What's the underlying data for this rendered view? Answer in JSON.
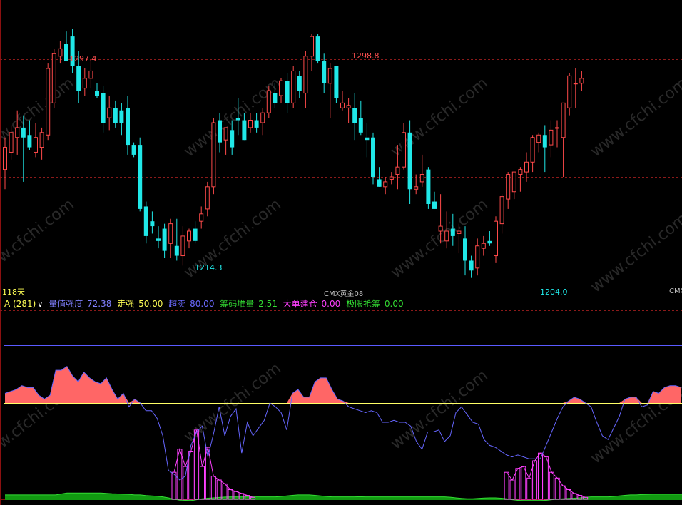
{
  "colors": {
    "up": "#ff4a4a",
    "down": "#20e8e8",
    "frame": "#8b1010",
    "grid": "#8b1a1a",
    "strength_line": "#6666ff",
    "strength_fill": "#ff6666",
    "level_high": "#5a5aff",
    "level_low": "#ffff66",
    "chip_pink": "#ff40ff",
    "chip_green": "#33dd33",
    "watermark": "#4a4a4a"
  },
  "top_labels": {
    "period": "118天",
    "symbol_mid": "CMX黄金08",
    "symbol_right": "CMX"
  },
  "price_labels": {
    "high1": "1297.4",
    "high2": "1298.8",
    "low1": "1214.3",
    "low2": "1204.0"
  },
  "legend": {
    "indicator": "A (281)",
    "dropdown_icon": "chevron-down-icon",
    "items": [
      {
        "name": "量值强度",
        "value": "72.38",
        "color": "#8080ff"
      },
      {
        "name": "走强",
        "value": "50.00",
        "color": "#ffff55"
      },
      {
        "name": "超卖",
        "value": "80.00",
        "color": "#6a6aff"
      },
      {
        "name": "筹码堆量",
        "value": "2.51",
        "color": "#33dd33"
      },
      {
        "name": "大单建仓",
        "value": "0.00",
        "color": "#ff40ff"
      },
      {
        "name": "极限抢筹",
        "value": "0.00",
        "color": "#33dd33"
      }
    ]
  },
  "watermark": "www.cfchi.com",
  "chart_data": [
    {
      "type": "candlestick",
      "title": "CMX黄金08",
      "ylim": [
        1196,
        1306
      ],
      "ohlc": [
        [
          1243,
          1256,
          1235,
          1252
        ],
        [
          1250,
          1261,
          1247,
          1258
        ],
        [
          1256,
          1267,
          1249,
          1260
        ],
        [
          1260,
          1265,
          1238,
          1256
        ],
        [
          1257,
          1263,
          1251,
          1252
        ],
        [
          1250,
          1262,
          1248,
          1256
        ],
        [
          1252,
          1260,
          1247,
          1258
        ],
        [
          1257,
          1286,
          1255,
          1284
        ],
        [
          1270,
          1292,
          1268,
          1290
        ],
        [
          1289,
          1295,
          1286,
          1292
        ],
        [
          1294,
          1299,
          1289,
          1287
        ],
        [
          1297,
          1300,
          1282,
          1285
        ],
        [
          1285,
          1291,
          1270,
          1275
        ],
        [
          1276,
          1284,
          1273,
          1280
        ],
        [
          1280,
          1287,
          1276,
          1283
        ],
        [
          1275,
          1278,
          1272,
          1273
        ],
        [
          1274,
          1277,
          1258,
          1262
        ],
        [
          1264,
          1273,
          1259,
          1268
        ],
        [
          1268,
          1271,
          1260,
          1262
        ],
        [
          1267,
          1270,
          1257,
          1262
        ],
        [
          1268,
          1273,
          1249,
          1253
        ],
        [
          1253,
          1254,
          1248,
          1249
        ],
        [
          1253,
          1256,
          1226,
          1227
        ],
        [
          1228,
          1230,
          1213,
          1216
        ],
        [
          1222,
          1226,
          1217,
          1220
        ],
        [
          1215,
          1220,
          1211,
          1214
        ],
        [
          1219,
          1221,
          1207,
          1210
        ],
        [
          1213,
          1223,
          1207,
          1221
        ],
        [
          1212,
          1223,
          1206,
          1208
        ],
        [
          1208,
          1220,
          1204,
          1216
        ],
        [
          1214,
          1219,
          1211,
          1218
        ],
        [
          1219,
          1222,
          1213,
          1214
        ],
        [
          1222,
          1228,
          1219,
          1225
        ],
        [
          1227,
          1238,
          1224,
          1236
        ],
        [
          1236,
          1264,
          1233,
          1262
        ],
        [
          1263,
          1266,
          1250,
          1254
        ],
        [
          1255,
          1260,
          1249,
          1260
        ],
        [
          1259,
          1263,
          1249,
          1252
        ],
        [
          1264,
          1272,
          1257,
          1263
        ],
        [
          1263,
          1266,
          1255,
          1255
        ],
        [
          1260,
          1266,
          1258,
          1263
        ],
        [
          1263,
          1266,
          1258,
          1260
        ],
        [
          1262,
          1268,
          1257,
          1266
        ],
        [
          1266,
          1277,
          1264,
          1275
        ],
        [
          1274,
          1278,
          1268,
          1270
        ],
        [
          1273,
          1280,
          1270,
          1279
        ],
        [
          1279,
          1282,
          1266,
          1270
        ],
        [
          1270,
          1285,
          1268,
          1283
        ],
        [
          1281,
          1283,
          1272,
          1275
        ],
        [
          1274,
          1291,
          1268,
          1289
        ],
        [
          1289,
          1298,
          1283,
          1297
        ],
        [
          1297,
          1298,
          1286,
          1287
        ],
        [
          1287,
          1290,
          1274,
          1278
        ],
        [
          1278,
          1286,
          1264,
          1284
        ],
        [
          1285,
          1285,
          1270,
          1272
        ],
        [
          1268,
          1275,
          1267,
          1270
        ],
        [
          1268,
          1272,
          1262,
          1269
        ],
        [
          1268,
          1274,
          1255,
          1262
        ],
        [
          1264,
          1271,
          1257,
          1258
        ],
        [
          1256,
          1262,
          1248,
          1255
        ],
        [
          1256,
          1258,
          1237,
          1240
        ],
        [
          1239,
          1244,
          1236,
          1236
        ],
        [
          1236,
          1240,
          1233,
          1238
        ],
        [
          1239,
          1242,
          1237,
          1240
        ],
        [
          1241,
          1253,
          1235,
          1244
        ],
        [
          1244,
          1262,
          1243,
          1258
        ],
        [
          1258,
          1263,
          1229,
          1235
        ],
        [
          1235,
          1241,
          1233,
          1236
        ],
        [
          1238,
          1249,
          1236,
          1241
        ],
        [
          1243,
          1244,
          1227,
          1229
        ],
        [
          1230,
          1234,
          1227,
          1227
        ],
        [
          1218,
          1233,
          1213,
          1220
        ],
        [
          1214,
          1226,
          1211,
          1218
        ],
        [
          1219,
          1225,
          1212,
          1216
        ],
        [
          1217,
          1221,
          1209,
          1218
        ],
        [
          1215,
          1220,
          1200,
          1206
        ],
        [
          1206,
          1208,
          1199,
          1202
        ],
        [
          1203,
          1215,
          1200,
          1212
        ],
        [
          1211,
          1216,
          1208,
          1213
        ],
        [
          1214,
          1218,
          1212,
          1213
        ],
        [
          1208,
          1224,
          1205,
          1222
        ],
        [
          1221,
          1233,
          1217,
          1232
        ],
        [
          1231,
          1242,
          1227,
          1241
        ],
        [
          1234,
          1242,
          1231,
          1242
        ],
        [
          1241,
          1244,
          1234,
          1243
        ],
        [
          1242,
          1250,
          1238,
          1246
        ],
        [
          1246,
          1257,
          1242,
          1256
        ],
        [
          1254,
          1258,
          1250,
          1257
        ],
        [
          1257,
          1261,
          1242,
          1252
        ],
        [
          1253,
          1263,
          1248,
          1259
        ],
        [
          1260,
          1263,
          1252,
          1260
        ],
        [
          1256,
          1262,
          1240,
          1270
        ],
        [
          1268,
          1282,
          1265,
          1281
        ],
        [
          1278,
          1284,
          1268,
          1278
        ],
        [
          1278,
          1283,
          1275,
          1280
        ]
      ],
      "labels": [
        {
          "text": "1297.4",
          "kind": "high"
        },
        {
          "text": "1298.8",
          "kind": "high"
        },
        {
          "text": "1214.3",
          "kind": "low"
        },
        {
          "text": "1204.0",
          "kind": "low"
        }
      ]
    },
    {
      "type": "area",
      "title": "A (281)",
      "ylim": [
        0,
        100
      ],
      "levels": [
        80,
        50
      ],
      "strength": [
        55,
        56,
        57,
        59,
        58,
        58,
        54,
        52,
        54,
        67,
        67,
        69,
        64,
        61,
        66,
        63,
        61,
        60,
        63,
        57,
        52,
        55,
        48,
        52,
        50,
        46,
        46,
        42,
        33,
        15,
        13,
        10,
        12,
        28,
        35,
        38,
        22,
        34,
        48,
        33,
        43,
        47,
        24,
        40,
        33,
        37,
        41,
        50,
        48,
        45,
        36,
        55,
        57,
        53,
        53,
        61,
        63,
        63,
        57,
        52,
        51,
        48,
        47,
        46,
        45,
        46,
        45,
        40,
        40,
        41,
        40,
        40,
        38,
        30,
        26,
        35,
        35,
        36,
        30,
        33,
        45,
        48,
        44,
        40,
        39,
        31,
        28,
        27,
        25,
        23,
        22,
        23,
        22,
        21,
        21,
        21,
        28,
        35,
        42,
        48,
        51,
        53,
        52,
        50,
        48,
        40,
        33,
        31,
        37,
        43,
        52,
        53,
        53,
        48,
        49,
        56,
        55,
        58,
        59,
        59,
        58
      ],
      "chip_bars": [
        0,
        0,
        0,
        0,
        0,
        0,
        0,
        0,
        0,
        0,
        0,
        0,
        0,
        0,
        0,
        0,
        0,
        0,
        0,
        0,
        0,
        0,
        0,
        0,
        0,
        0,
        0,
        0,
        0,
        0,
        14,
        26,
        17,
        25,
        36,
        17,
        27,
        12,
        10,
        8,
        5,
        4,
        3,
        2,
        1,
        0,
        0,
        0,
        0,
        0,
        0,
        0,
        0,
        0,
        0,
        0,
        0,
        0,
        0,
        0,
        0,
        0,
        0,
        0,
        0,
        0,
        0,
        0,
        0,
        0,
        0,
        0,
        0,
        0,
        0,
        0,
        0,
        0,
        0,
        0,
        0,
        0,
        0,
        0,
        0,
        0,
        0,
        0,
        0,
        14,
        10,
        16,
        17,
        11,
        20,
        24,
        22,
        14,
        11,
        7,
        5,
        3,
        2,
        1,
        0,
        0,
        0,
        0,
        0,
        0,
        0,
        0,
        0,
        0,
        0,
        0,
        0,
        0,
        0,
        0,
        0
      ],
      "green_base": [
        3,
        3,
        3,
        3,
        3,
        3,
        3,
        3,
        3,
        3,
        3.5,
        4,
        4,
        4,
        4,
        4,
        4,
        4,
        3.8,
        3.6,
        3.5,
        3.4,
        3.3,
        3,
        3,
        2.7,
        2.5,
        2.3,
        2,
        1.5,
        0.8,
        0.3,
        0.2,
        0,
        0.5,
        1,
        1.3,
        1.5,
        1.7,
        1.9,
        2,
        2,
        2,
        2,
        2,
        2,
        2,
        2,
        2,
        2.2,
        2.5,
        2.8,
        3,
        3,
        3,
        2.8,
        2.5,
        2.2,
        2,
        2,
        2,
        2,
        2,
        2.1,
        2,
        2,
        2,
        2,
        2,
        2,
        2,
        2,
        2,
        2,
        2,
        2,
        2,
        2,
        2,
        1.8,
        1.5,
        1.2,
        1,
        1,
        1.2,
        1.4,
        1.5,
        1.5,
        1.3,
        1,
        0.5,
        0.2,
        0,
        0,
        0,
        0,
        0.2,
        0.5,
        0.8,
        1,
        1.2,
        1.3,
        1.5,
        1.8,
        2,
        2,
        2,
        2,
        2.2,
        2.5,
        2.8,
        3,
        3,
        3.2,
        3.3,
        3.4,
        3.4,
        3.4,
        3.4,
        3.4,
        3.4,
        3.4
      ]
    }
  ]
}
